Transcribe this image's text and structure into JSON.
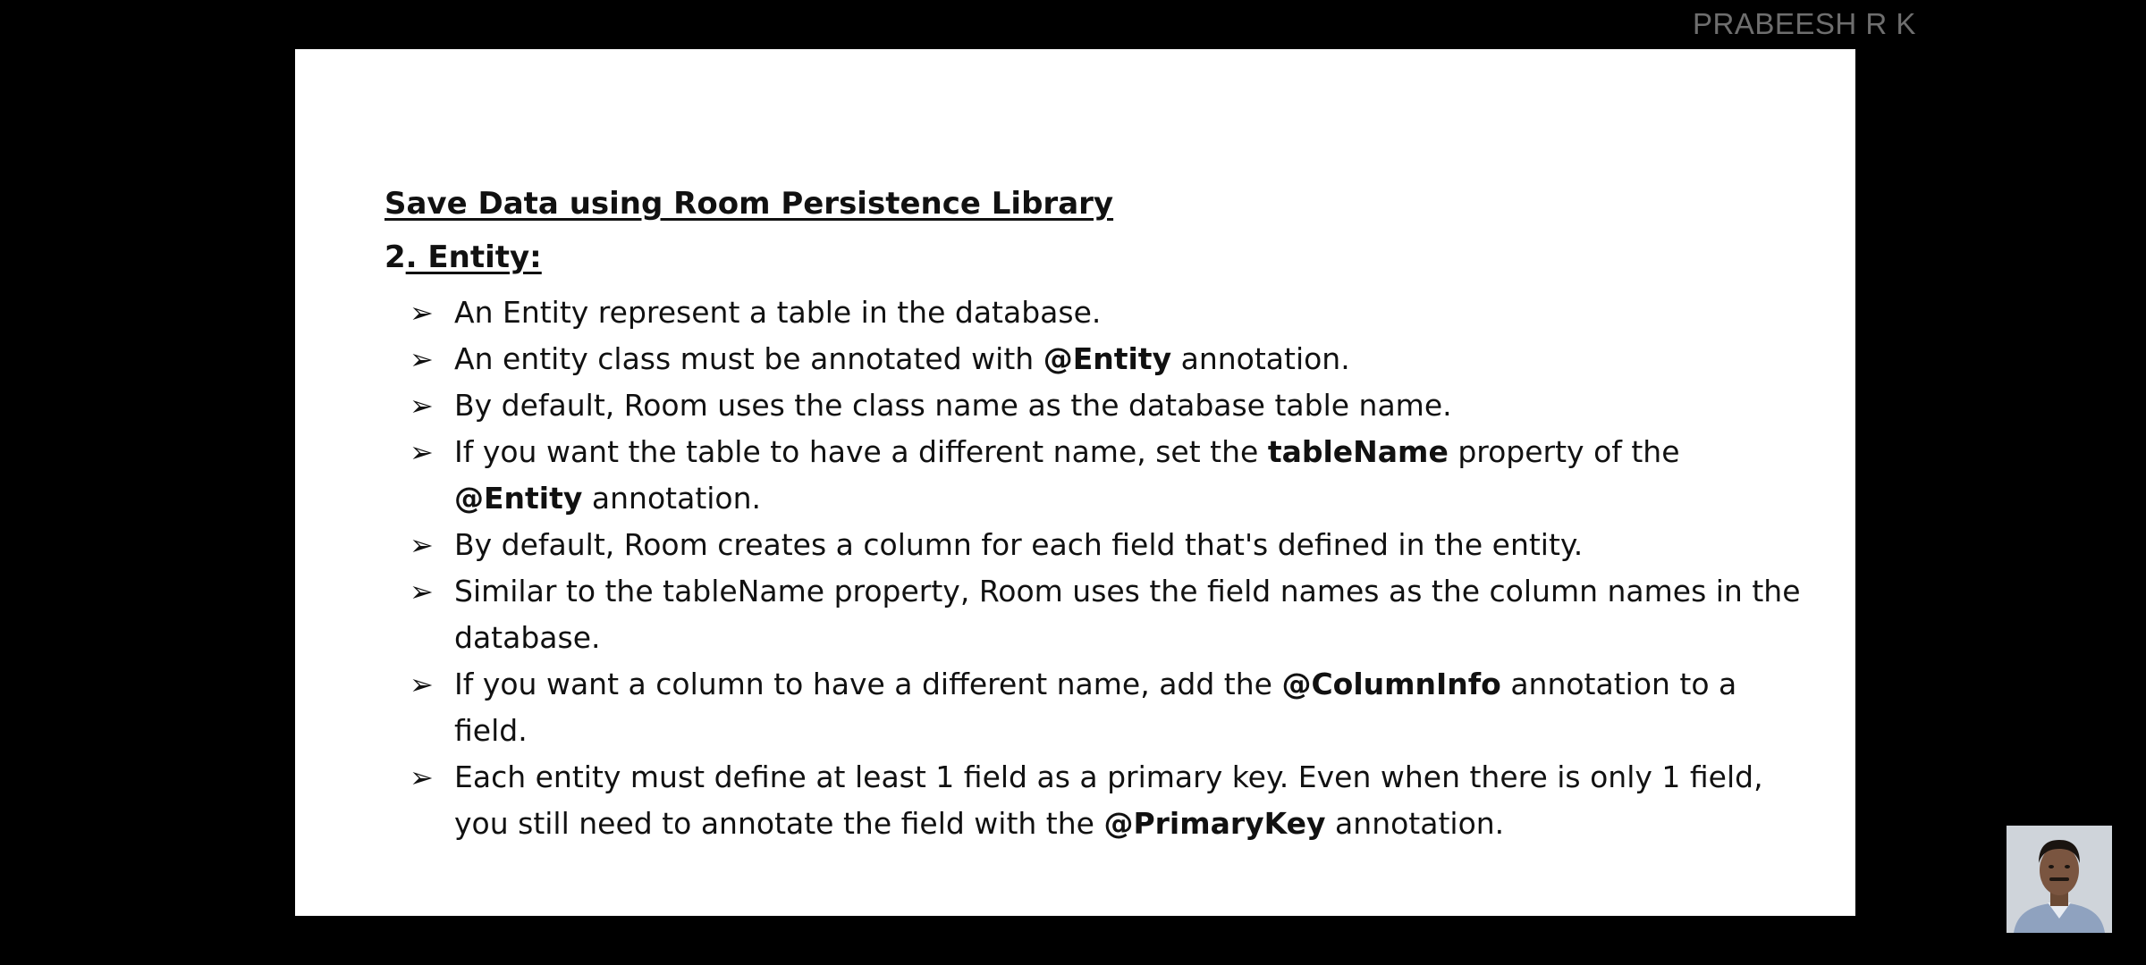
{
  "watermark": "PRABEESH R K",
  "slide": {
    "title": "Save Data using  Room Persistence Library",
    "section": {
      "number": "2",
      "label": ". Entity:"
    },
    "bullets": [
      {
        "parts": [
          {
            "t": "An Entity represent a table in the database."
          }
        ]
      },
      {
        "parts": [
          {
            "t": "An entity class must be annotated with "
          },
          {
            "t": "@Entity",
            "b": true
          },
          {
            "t": " annotation."
          }
        ]
      },
      {
        "parts": [
          {
            "t": "By default, Room uses the class name as the database table name."
          }
        ]
      },
      {
        "parts": [
          {
            "t": "If you want the table to have a different name, set the "
          },
          {
            "t": "tableName",
            "b": true
          },
          {
            "t": " property of the "
          },
          {
            "t": "@Entity",
            "b": true
          },
          {
            "t": " annotation."
          }
        ]
      },
      {
        "parts": [
          {
            "t": "By default, Room creates a column for each field that's defined in the entity."
          }
        ]
      },
      {
        "parts": [
          {
            "t": "Similar to the tableName property, Room uses the field names as the column names in the database."
          }
        ]
      },
      {
        "parts": [
          {
            "t": " If you want a column to have a different name, add the "
          },
          {
            "t": "@ColumnInfo",
            "b": true
          },
          {
            "t": " annotation to a field."
          }
        ]
      },
      {
        "parts": [
          {
            "t": "Each entity must define at least 1 field as a primary key. Even when there is only 1 field, you still need to annotate the field with the "
          },
          {
            "t": "@PrimaryKey",
            "b": true
          },
          {
            "t": " annotation."
          }
        ]
      }
    ]
  },
  "presenter_thumbnail": "presenter-photo"
}
